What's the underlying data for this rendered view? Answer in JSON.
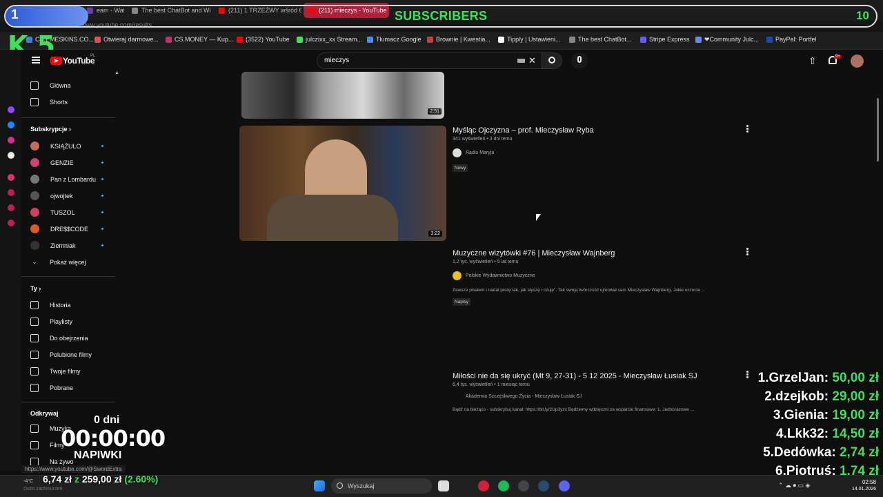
{
  "browser": {
    "tabs": [
      {
        "label": "eam - Watc",
        "color": "#6441a5"
      },
      {
        "label": "The best ChatBot and Wi",
        "color": "#888888"
      },
      {
        "label": "(211) 1 TRZEŹWY wśród 6",
        "color": "#ff0000"
      },
      {
        "label": "(211) mieczys - YouTube",
        "color": "#ff0000"
      }
    ],
    "url": "www.youtube.com/results",
    "bookmarks": [
      {
        "label": "CS.EMESKINS.CO...",
        "color": "#4a7dd8"
      },
      {
        "label": "Otwieraj darmowe...",
        "color": "#e05050"
      },
      {
        "label": "CS.MONEY — Kup...",
        "color": "#c03070"
      },
      {
        "label": "(3522) YouTube",
        "color": "#ff0000"
      },
      {
        "label": "julczixx_xx Stream...",
        "color": "#3ee25a"
      },
      {
        "label": "Tłumacz Google",
        "color": "#4a8af4"
      },
      {
        "label": "Brownie | Kwestia...",
        "color": "#c04040"
      },
      {
        "label": "Tipply | Ustawieni...",
        "color": "#ffffff"
      },
      {
        "label": "The best ChatBot...",
        "color": "#888888"
      },
      {
        "label": "Stripe Express",
        "color": "#635bff"
      },
      {
        "label": "❤Community Julc...",
        "color": "#6a8af0"
      },
      {
        "label": "PayPal: Portfel",
        "color": "#1a4ab0"
      }
    ]
  },
  "overlay": {
    "left_count": "1",
    "title": "SUBSCRIBERS",
    "right_count": "10",
    "logo": "K 5",
    "timer_days": "0 dni",
    "timer_clock": "00:00:00",
    "timer_label": "NAPIWKI",
    "goal_current": "6,74 zł",
    "goal_sep": "z",
    "goal_target": "259,00 zł",
    "goal_percent": "(2.60%)",
    "tips": [
      {
        "rank": "1.",
        "name": "GrzelJan:",
        "amount": "50,00 zł"
      },
      {
        "rank": "2.",
        "name": "dzejkob:",
        "amount": "29,00 zł"
      },
      {
        "rank": "3.",
        "name": "Gienia:",
        "amount": "19,00 zł"
      },
      {
        "rank": "4.",
        "name": "Lkk32:",
        "amount": "14,50 zł"
      },
      {
        "rank": "5.",
        "name": "Dedówka:",
        "amount": "2,74 zł"
      },
      {
        "rank": "6.",
        "name": "Piotruś:",
        "amount": "1,74 zł"
      }
    ]
  },
  "youtube": {
    "logo_text": "YouTube",
    "logo_region": "PL",
    "search_value": "mieczys",
    "notification_count": "9+",
    "nav_main": [
      {
        "label": "Główna",
        "icon": "home-icon"
      },
      {
        "label": "Shorts",
        "icon": "shorts-icon"
      }
    ],
    "subscriptions_header": "Subskrypcje",
    "subscriptions": [
      {
        "label": "KSIĄŻULO",
        "color": "#c07050"
      },
      {
        "label": "GENZIE",
        "color": "#d04070"
      },
      {
        "label": "Pan z Lombardu",
        "color": "#777777"
      },
      {
        "label": "ojwojtek",
        "color": "#555555"
      },
      {
        "label": "TUSZOL",
        "color": "#d04060"
      },
      {
        "label": "DRE$$CODE",
        "color": "#e05a20"
      },
      {
        "label": "Ziemniak",
        "color": "#333333"
      }
    ],
    "show_more": "Pokaż więcej",
    "you_header": "Ty",
    "you_items": [
      {
        "label": "Historia",
        "icon": "history-icon"
      },
      {
        "label": "Playlisty",
        "icon": "playlist-icon"
      },
      {
        "label": "Do obejrzenia",
        "icon": "watch-later-icon"
      },
      {
        "label": "Polubione filmy",
        "icon": "like-icon"
      },
      {
        "label": "Twoje filmy",
        "icon": "your-videos-icon"
      },
      {
        "label": "Pobrane",
        "icon": "download-icon"
      }
    ],
    "explore_header": "Odkrywaj",
    "explore_items": [
      {
        "label": "Muzyka",
        "icon": "music-icon"
      },
      {
        "label": "Filmy",
        "icon": "movies-icon"
      },
      {
        "label": "Na żywo",
        "icon": "live-icon"
      }
    ],
    "videos": [
      {
        "duration": "2:51"
      },
      {
        "title": "Myśląc Ojczyzna – prof. Mieczysław Ryba",
        "meta": "341 wyświetleń • 3 dni temu",
        "channel": "Radio Maryja",
        "badge": "Nowy",
        "duration": "3:22"
      },
      {
        "title": "Muzyczne wizytówki #76 | Mieczysław Wajnberg",
        "meta": "1,2 tys. wyświetleń • 5 lat temu",
        "channel": "Polskie Wydawnictwo Muzyczne",
        "desc": "Zawsze pisałem i nadal piszę tak, jak słyszę i czuję\". Tak swoją twórczość ujmował sam Mieczysław Wajnberg. Jakie uczucia ...",
        "badge": "Napisy"
      },
      {
        "title": "Miłości nie da się ukryć (Mt 9, 27-31) - 5 12 2025 - Mieczysław Łusiak SJ",
        "meta": "6,4 tys. wyświetleń • 1 miesiąc temu",
        "channel": "Akademia Szczęśliwego Życia - Mieczysław Łusiak SJ",
        "desc": "Bądź na bieżąco - subskrybuj kanał: https://bit.ly/2Up3yzc Będziemy wdzięczni za wsparcie finansowe: 1. Jednorazowe ..."
      }
    ]
  },
  "statusbar": {
    "link": "https://www.youtube.com/@SwordExtra",
    "weather": "-4°C",
    "weather_sub": "Dużo zachmurzeń"
  },
  "taskbar": {
    "search_placeholder": "Wyszukaj",
    "time": "02:58",
    "date": "14.01.2026"
  }
}
